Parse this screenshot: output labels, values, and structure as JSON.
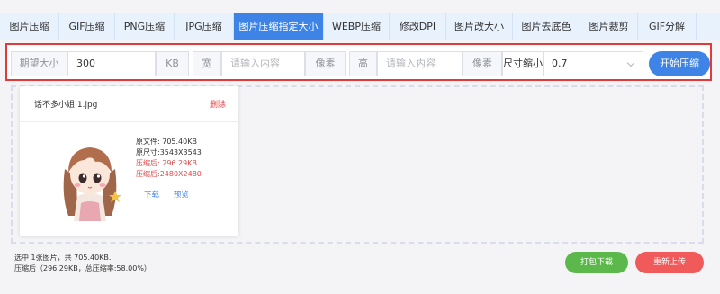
{
  "tabs": [
    {
      "label": "图片压缩",
      "width": 66
    },
    {
      "label": "GIF压缩",
      "width": 62
    },
    {
      "label": "PNG压缩",
      "width": 66
    },
    {
      "label": "JPG压缩",
      "width": 66
    },
    {
      "label": "图片压缩指定大小",
      "width": 100
    },
    {
      "label": "WEBP压缩",
      "width": 73
    },
    {
      "label": "修改DPI",
      "width": 63
    },
    {
      "label": "图片改大小",
      "width": 74
    },
    {
      "label": "图片去底色",
      "width": 75
    },
    {
      "label": "图片裁剪",
      "width": 64
    },
    {
      "label": "GIF分解",
      "width": 65
    }
  ],
  "active_tab": "图片压缩指定大小",
  "options": {
    "expected_size_label": "期望大小",
    "expected_size_value": "300",
    "expected_size_unit": "KB",
    "width_label": "宽",
    "width_placeholder": "请输入内容",
    "width_unit": "像素",
    "height_label": "高",
    "height_placeholder": "请输入内容",
    "height_unit": "像素",
    "scale_label": "尺寸缩小",
    "scale_value": "0.7",
    "start_button": "开始压缩"
  },
  "file_card": {
    "file_name": "话不多小姐 1.jpg",
    "delete_label": "删除",
    "original_size": "原文件: 705.40KB",
    "original_dims": "原尺寸:3543X3543",
    "compressed_size": "压缩后: 296.29KB",
    "compressed_dims": "压缩后:2480X2480",
    "download_label": "下载",
    "preview_label": "预览"
  },
  "summary": {
    "line1": "选中 1张图片，共 705.40KB.",
    "line2": "压缩后（296.29KB，总压缩率:58.00%）"
  },
  "actions": {
    "pack_download": "打包下载",
    "reupload": "重新上传"
  },
  "colors": {
    "accent": "#3e84e6",
    "highlight_border": "#e03a3a",
    "delete": "#e04848",
    "green_button": "#5cb84a",
    "red_button": "#f05a5a"
  }
}
